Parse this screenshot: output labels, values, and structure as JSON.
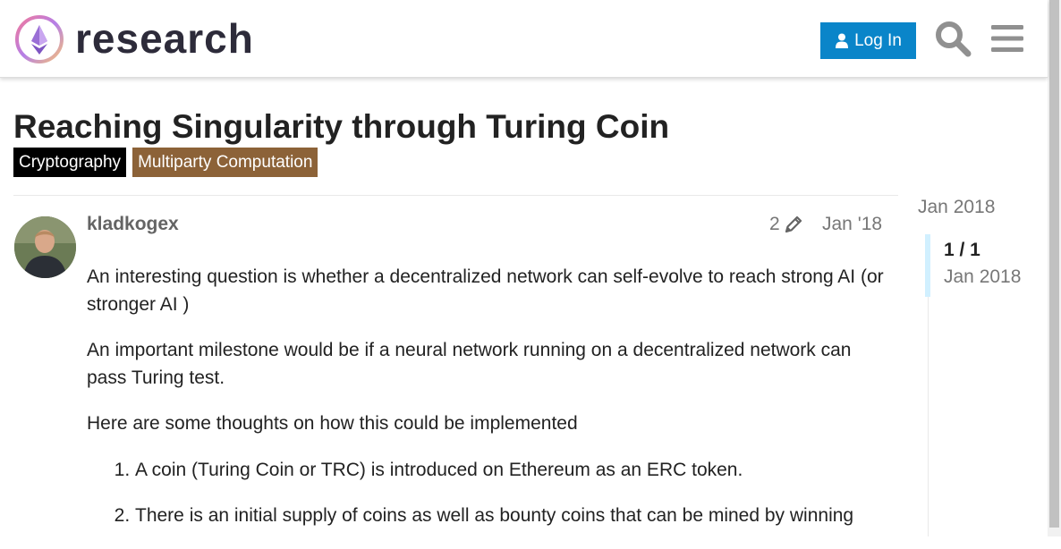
{
  "header": {
    "logo_text": "research",
    "login_label": "Log In",
    "search_icon": "search-icon",
    "menu_icon": "hamburger-menu-icon",
    "brand_color": "#0a85c9"
  },
  "topic": {
    "title": "Reaching Singularity through Turing Coin",
    "tags": [
      {
        "label": "Cryptography",
        "color": "#000000"
      },
      {
        "label": "Multiparty Computation",
        "color": "#8c6238"
      }
    ]
  },
  "post": {
    "author": "kladkogex",
    "edit_count": "2",
    "edit_icon": "pencil-icon",
    "date": "Jan '18",
    "paragraphs": [
      "An interesting question is whether a decentralized network can self-evolve to reach strong AI (or stronger AI )",
      "An important milestone would be if a neural network running on a decentralized network can pass Turing test.",
      "Here are some thoughts on how this could be implemented"
    ],
    "list_items": [
      "A coin (Turing Coin or TRC) is introduced on Ethereum as an ERC token.",
      "There is an initial supply of coins as well as bounty coins that can be mined by winning"
    ]
  },
  "timeline": {
    "start_date": "Jan 2018",
    "counter": "1 / 1",
    "current_date": "Jan 2018"
  }
}
